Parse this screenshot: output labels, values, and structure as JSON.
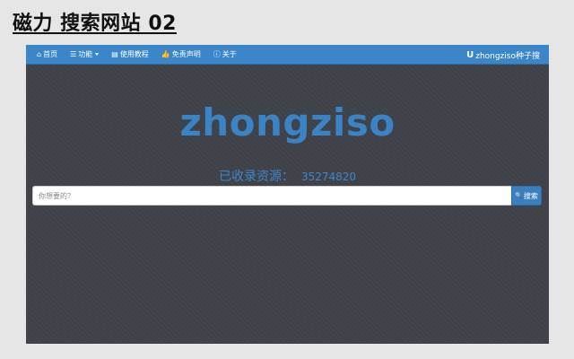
{
  "heading": "磁力 搜索网站 02",
  "navbar": {
    "items": [
      {
        "label": "首页",
        "icon": "home-icon",
        "glyph": "⌂"
      },
      {
        "label": "功能",
        "icon": "list-icon",
        "glyph": "☰",
        "dropdown": true
      },
      {
        "label": "使用教程",
        "icon": "book-icon",
        "glyph": "▤"
      },
      {
        "label": "免责声明",
        "icon": "thumbs-up-icon",
        "glyph": "👍"
      },
      {
        "label": "关于",
        "icon": "info-icon",
        "glyph": "ⓘ"
      }
    ],
    "brand": {
      "label": "zhongziso种子搜",
      "icon": "magnet-icon",
      "glyph": "U"
    }
  },
  "main": {
    "logo": "zhongziso",
    "count_label": "已收录资源：",
    "count_value": "35274820",
    "search": {
      "placeholder": "你想要的？",
      "value": "",
      "button_label": "搜索",
      "button_icon": "search-icon",
      "button_glyph": "🔍"
    }
  },
  "colors": {
    "navbar": "#3a86c8",
    "background": "#3f4249",
    "accent": "#3a83c4"
  }
}
